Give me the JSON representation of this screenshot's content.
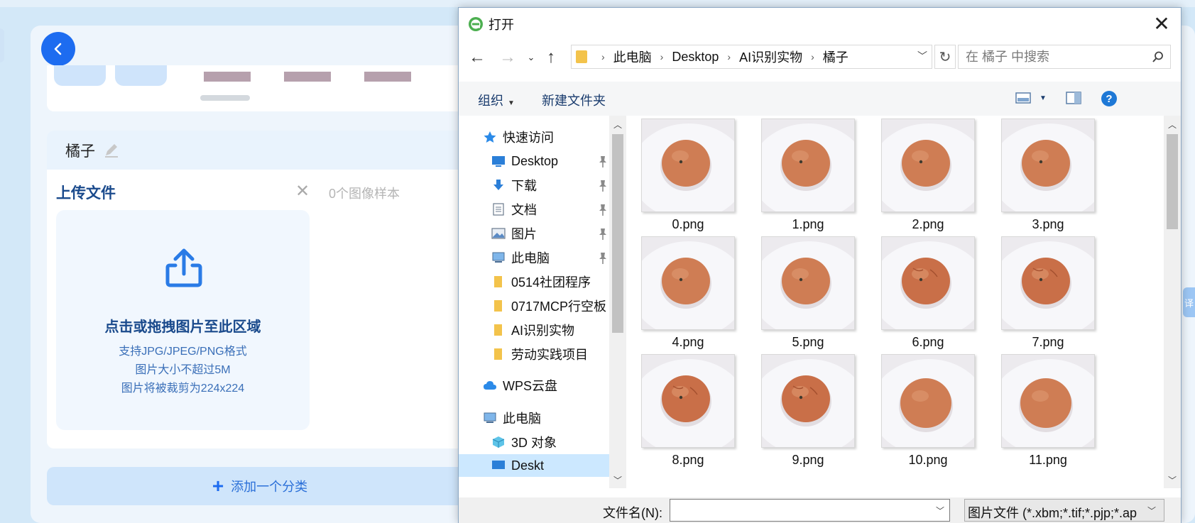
{
  "app": {
    "class_name": "橘子",
    "upload_title": "上传文件",
    "sample_count": "0个图像样本",
    "close_symbol": "✕",
    "drop_main": "点击或拖拽图片至此区域",
    "drop_formats": "支持JPG/JPEG/PNG格式",
    "drop_size": "图片大小不超过5M",
    "drop_crop": "图片将被裁剪为224x224",
    "add_class_label": "添加一个分类",
    "side_tag": "译",
    "accent_color": "#1d6cf0"
  },
  "dialog": {
    "title": "打开",
    "breadcrumb": [
      "此电脑",
      "Desktop",
      "AI识别实物",
      "橘子"
    ],
    "search_placeholder": "在 橘子 中搜索",
    "toolbar": {
      "organize": "组织",
      "new_folder": "新建文件夹"
    },
    "nav": {
      "quick_access": "快速访问",
      "items": [
        {
          "label": "Desktop",
          "icon": "desktop-icon",
          "pinned": true
        },
        {
          "label": "下载",
          "icon": "download-icon",
          "pinned": true
        },
        {
          "label": "文档",
          "icon": "document-icon",
          "pinned": true
        },
        {
          "label": "图片",
          "icon": "pictures-icon",
          "pinned": true
        },
        {
          "label": "此电脑",
          "icon": "computer-icon",
          "pinned": true
        },
        {
          "label": "0514社团程序",
          "icon": "folder-icon",
          "pinned": false
        },
        {
          "label": "0717MCP行空板",
          "icon": "folder-icon",
          "pinned": false
        },
        {
          "label": "AI识别实物",
          "icon": "folder-icon",
          "pinned": false
        },
        {
          "label": "劳动实践项目",
          "icon": "folder-icon",
          "pinned": false
        }
      ],
      "wps_cloud": "WPS云盘",
      "this_pc": "此电脑",
      "objects_3d": "3D 对象",
      "desktop_partial": "Deskt"
    },
    "files": [
      "0.png",
      "1.png",
      "2.png",
      "3.png",
      "4.png",
      "5.png",
      "6.png",
      "7.png",
      "8.png",
      "9.png",
      "10.png",
      "11.png"
    ],
    "file_name_label": "文件名(N):",
    "file_name_value": "",
    "file_type": "图片文件 (*.xbm;*.tif;*.pjp;*.ap"
  }
}
